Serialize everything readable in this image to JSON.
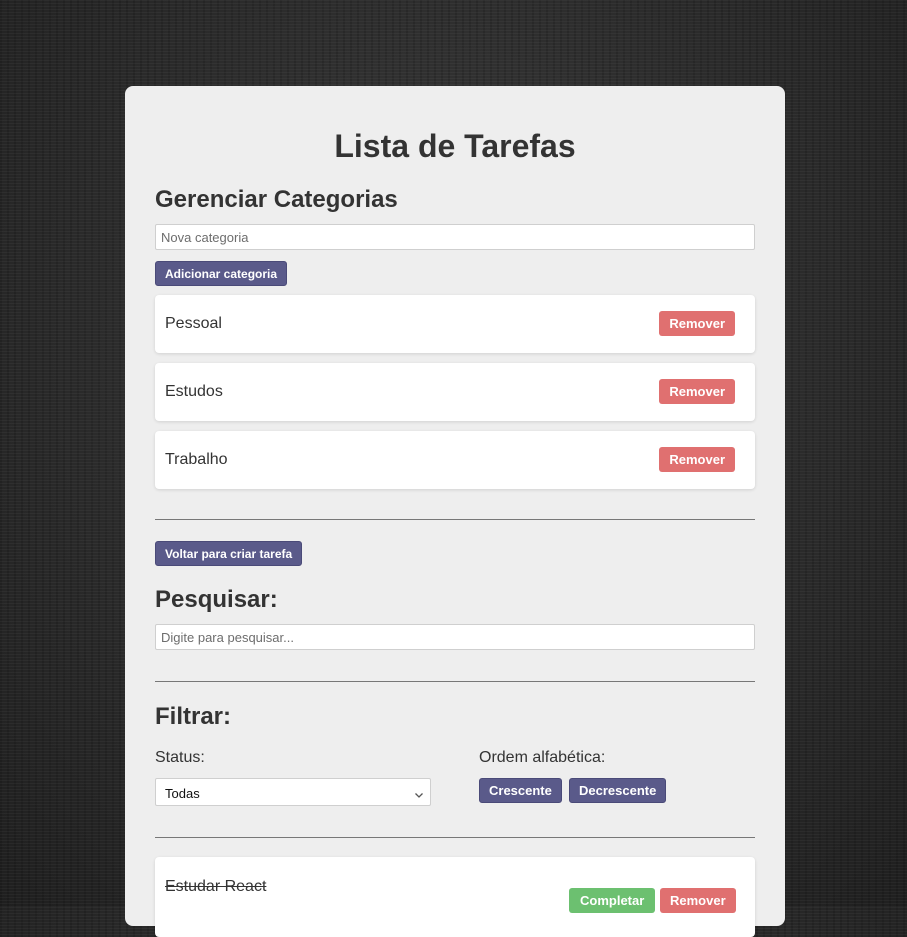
{
  "app": {
    "title": "Lista de Tarefas"
  },
  "categories": {
    "heading": "Gerenciar Categorias",
    "input": {
      "placeholder": "Nova categoria",
      "value": ""
    },
    "add_label": "Adicionar categoria",
    "items": [
      {
        "name": "Pessoal",
        "remove_label": "Remover"
      },
      {
        "name": "Estudos",
        "remove_label": "Remover"
      },
      {
        "name": "Trabalho",
        "remove_label": "Remover"
      }
    ]
  },
  "back_label": "Voltar para criar tarefa",
  "search": {
    "heading": "Pesquisar:",
    "placeholder": "Digite para pesquisar...",
    "value": ""
  },
  "filter": {
    "heading": "Filtrar:",
    "status_label": "Status:",
    "status_value": "Todas",
    "order_label": "Ordem alfabética:",
    "asc_label": "Crescente",
    "desc_label": "Decrescente"
  },
  "tasks": [
    {
      "title": "Estudar React",
      "completed": true,
      "complete_label": "Completar",
      "remove_label": "Remover"
    }
  ],
  "colors": {
    "primary": "#5a5a8a",
    "danger": "#e07070",
    "success": "#6cc070",
    "card_bg": "#eeeeee"
  }
}
